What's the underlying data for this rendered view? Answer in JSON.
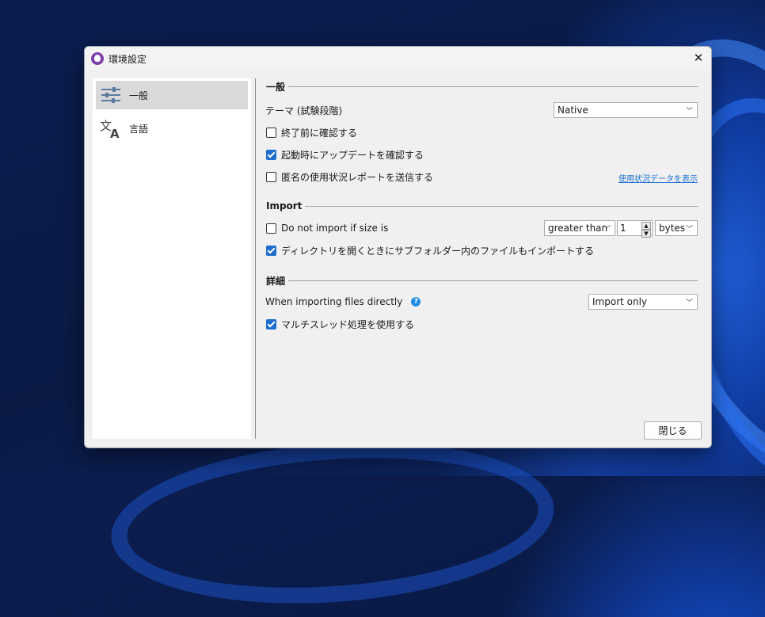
{
  "window": {
    "title": "環境設定",
    "close_glyph": "✕"
  },
  "sidebar": {
    "items": [
      {
        "label": "一般",
        "icon": "sliders-icon",
        "selected": true
      },
      {
        "label": "言語",
        "icon": "translate-icon",
        "selected": false
      }
    ]
  },
  "general": {
    "heading": "一般",
    "theme_label": "テーマ (試験段階)",
    "theme_value": "Native",
    "confirm_exit": {
      "label": "終了前に確認する",
      "checked": false
    },
    "check_updates": {
      "label": "起動時にアップデートを確認する",
      "checked": true
    },
    "send_usage": {
      "label": "匿名の使用状況レポートを送信する",
      "checked": false
    },
    "usage_link": "使用状況データを表示"
  },
  "import": {
    "heading": "Import",
    "size_rule": {
      "label": "Do not import if size is",
      "checked": false
    },
    "comparator": "greater than",
    "size_value": "1",
    "unit": "bytes",
    "subfolders": {
      "label": "ディレクトリを開くときにサブフォルダー内のファイルもインポートする",
      "checked": true
    }
  },
  "advanced": {
    "heading": "詳細",
    "direct_label": "When importing files directly",
    "help_glyph": "?",
    "direct_value": "Import only",
    "multithread": {
      "label": "マルチスレッド処理を使用する",
      "checked": true
    }
  },
  "footer": {
    "close_label": "閉じる"
  },
  "colors": {
    "accent": "#1c6dd0",
    "link": "#1a6fd0",
    "help": "#1e8ee8",
    "app_icon": "#7c3fa8"
  }
}
